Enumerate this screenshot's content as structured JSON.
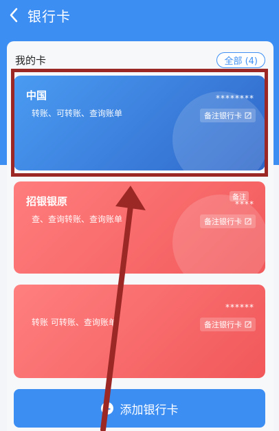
{
  "header": {
    "title": "银行卡",
    "back_icon": "chevron-left-icon"
  },
  "panel": {
    "title": "我的卡",
    "all_label": "全部 (4)"
  },
  "cards": [
    {
      "bank": "中国",
      "services": "转账、可转账、查询账单",
      "masked": "********",
      "note": "备注银行卡",
      "color": "#3c7de0"
    },
    {
      "bank": "招银银原",
      "services": "查、查询转账、查询账单",
      "masked": "****",
      "tag": "备注",
      "note": "备注银行卡",
      "color": "#f56a6c"
    },
    {
      "bank": "",
      "services": "转账  可转账、查询账单",
      "masked": "******",
      "note": "备注银行卡",
      "color": "#f36668"
    }
  ],
  "add_button": {
    "label": "添加银行卡"
  },
  "annotation": {
    "color": "#9c2826"
  }
}
